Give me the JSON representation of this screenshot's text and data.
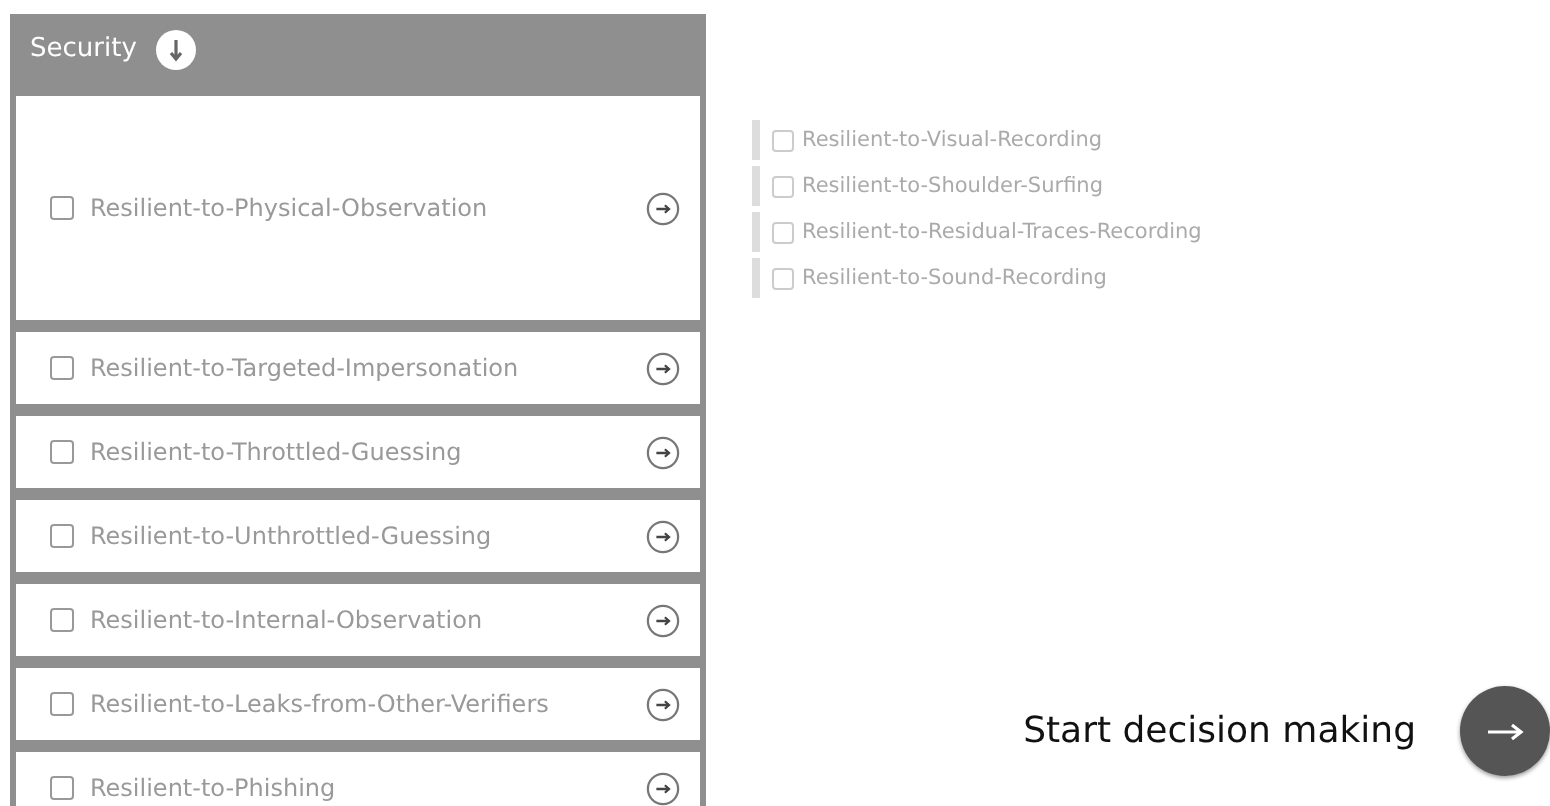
{
  "panel": {
    "title": "Security",
    "items": [
      {
        "label": "Resilient-to-Physical-Observation",
        "checked": false,
        "expanded": true
      },
      {
        "label": "Resilient-to-Targeted-Impersonation",
        "checked": false,
        "expanded": false
      },
      {
        "label": "Resilient-to-Throttled-Guessing",
        "checked": false,
        "expanded": false
      },
      {
        "label": "Resilient-to-Unthrottled-Guessing",
        "checked": false,
        "expanded": false
      },
      {
        "label": "Resilient-to-Internal-Observation",
        "checked": false,
        "expanded": false
      },
      {
        "label": "Resilient-to-Leaks-from-Other-Verifiers",
        "checked": false,
        "expanded": false
      },
      {
        "label": "Resilient-to-Phishing",
        "checked": false,
        "expanded": false
      }
    ]
  },
  "sub_items": [
    {
      "label": "Resilient-to-Visual-Recording",
      "checked": false
    },
    {
      "label": "Resilient-to-Shoulder-Surfing",
      "checked": false
    },
    {
      "label": "Resilient-to-Residual-Traces-Recording",
      "checked": false
    },
    {
      "label": "Resilient-to-Sound-Recording",
      "checked": false
    }
  ],
  "start": {
    "label": "Start decision making"
  }
}
